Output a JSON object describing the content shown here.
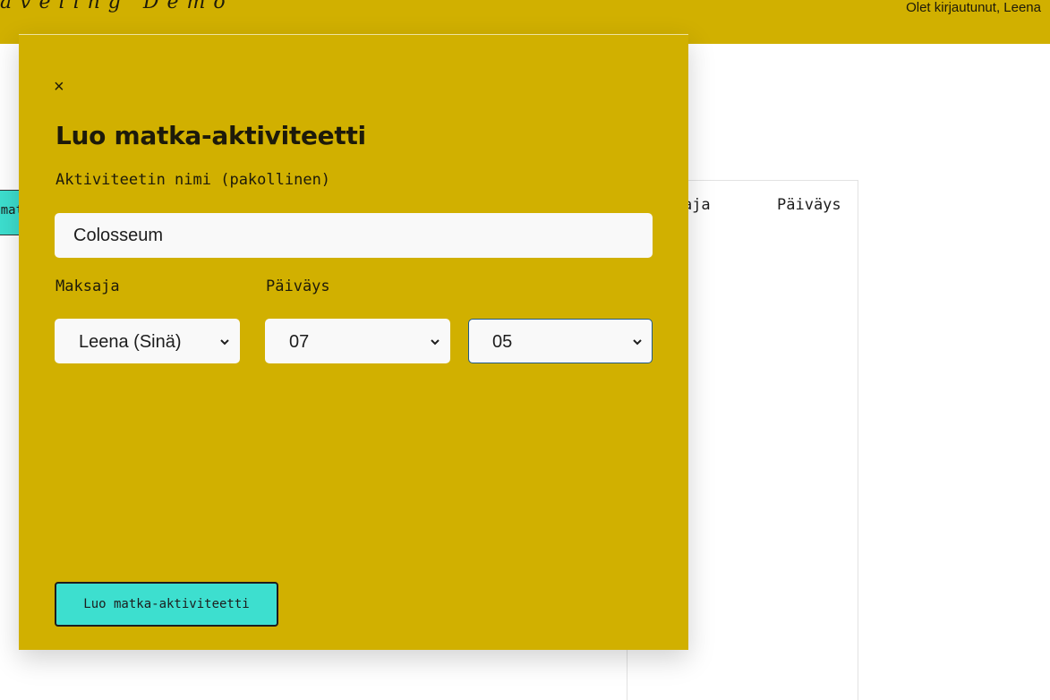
{
  "header": {
    "brand": "aveling Demo",
    "login_status": "Olet kirjautunut, Leena"
  },
  "background": {
    "button_label": "Luo matka-aktiviteetti",
    "column_payer": "Maksaja",
    "column_date": "Päiväys"
  },
  "modal": {
    "close_label": "×",
    "title": "Luo matka-aktiviteetti",
    "name_label": "Aktiviteetin nimi (pakollinen)",
    "name_value": "Colosseum",
    "payer_label": "Maksaja",
    "payer_value": "Leena (Sinä)",
    "date_label": "Päiväys",
    "month_value": "07",
    "day_value": "05",
    "submit_label": "Luo matka-aktiviteetti"
  },
  "colors": {
    "accent": "#d1b000",
    "button": "#3ddfcf",
    "input_bg": "#f9f9f9",
    "focus_border": "#1f5a8a"
  }
}
